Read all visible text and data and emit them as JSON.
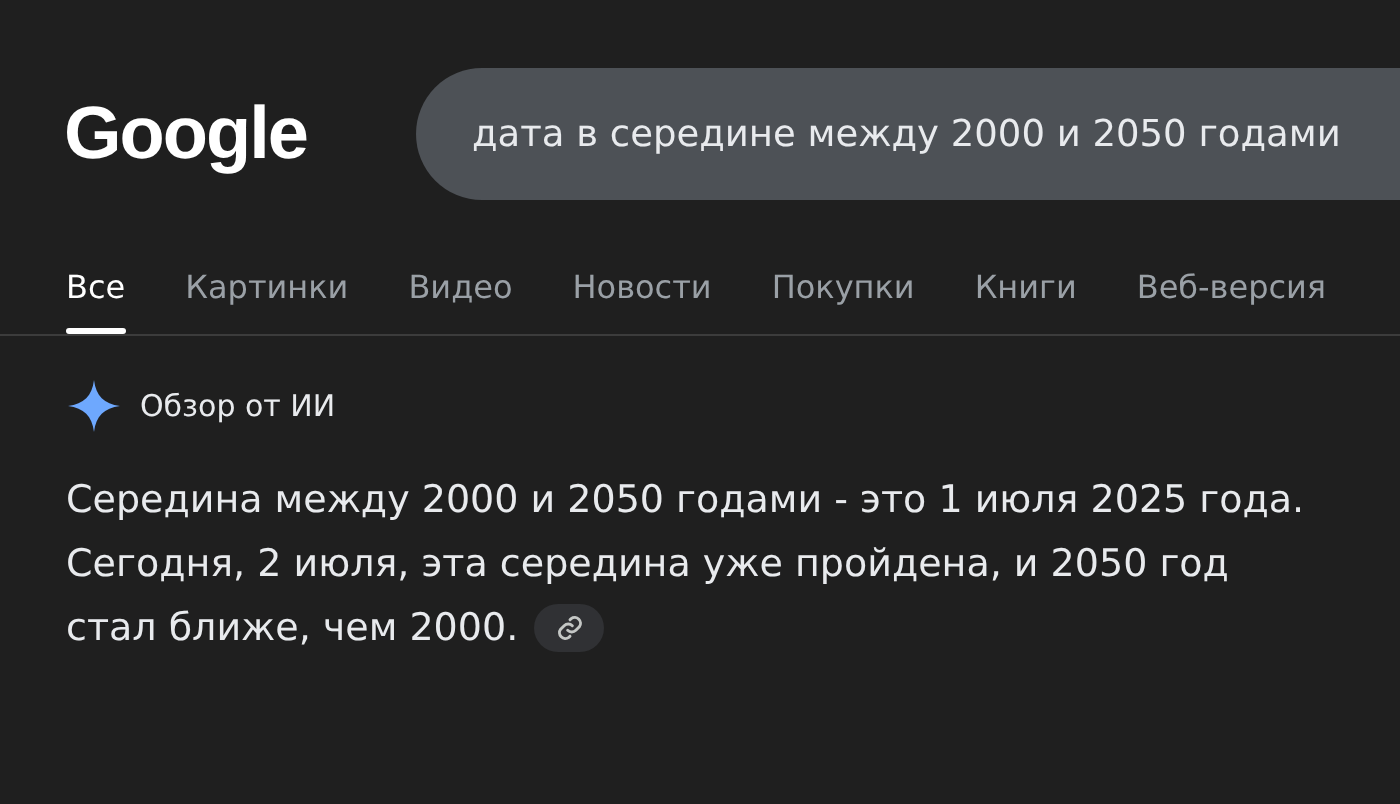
{
  "logo": "Google",
  "search": {
    "value": "дата в середине между 2000 и 2050 годами"
  },
  "tabs": [
    {
      "label": "Все",
      "selected": true
    },
    {
      "label": "Картинки",
      "selected": false
    },
    {
      "label": "Видео",
      "selected": false
    },
    {
      "label": "Новости",
      "selected": false
    },
    {
      "label": "Покупки",
      "selected": false
    },
    {
      "label": "Книги",
      "selected": false
    },
    {
      "label": "Веб-версия",
      "selected": false
    }
  ],
  "ai_overview": {
    "title": "Обзор от ИИ",
    "answer": [
      "Середина между 2000 и 2050 годами - это 1 июля 2025 года. Сегодня, 2 июля, эта середина уже пройдена, и 2050 год",
      "стал ближе, чем 2000."
    ]
  }
}
